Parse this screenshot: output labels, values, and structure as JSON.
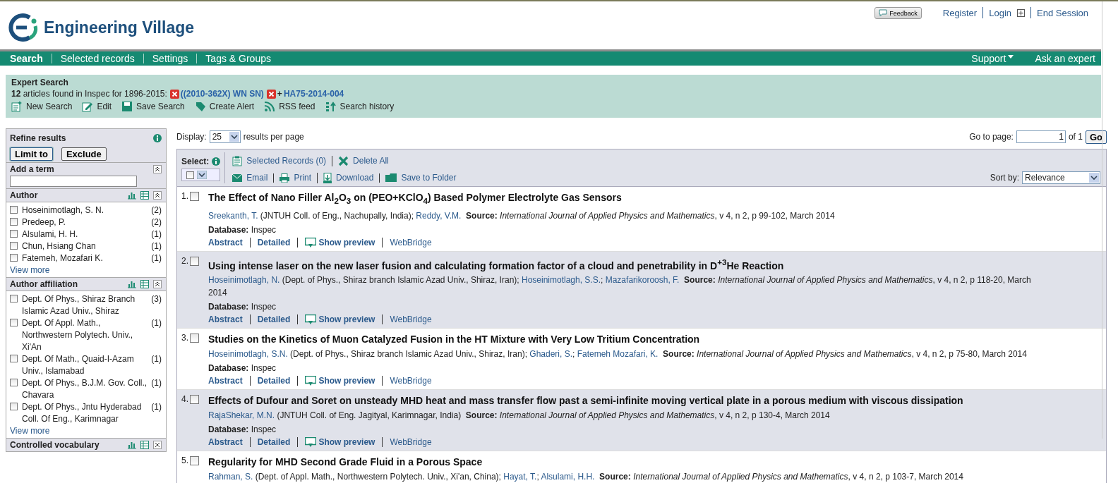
{
  "header": {
    "brand": "Engineering Village",
    "feedback": "Feedback",
    "links": [
      {
        "label": "Register",
        "kind": "link"
      },
      {
        "label": "Login",
        "kind": "login"
      },
      {
        "label": "End Session",
        "kind": "link"
      }
    ]
  },
  "nav": {
    "items": [
      {
        "label": "Search",
        "selected": true
      },
      {
        "label": "Selected records",
        "selected": false
      },
      {
        "label": "Settings",
        "selected": false
      },
      {
        "label": "Tags & Groups",
        "selected": false
      }
    ],
    "right": [
      {
        "label": "Support",
        "kind": "menu"
      },
      {
        "label": "Ask an expert",
        "kind": "link"
      }
    ]
  },
  "search_summary": {
    "title": "Expert Search",
    "found": "**12** articles found in Inspec for 1896-2015:",
    "terms": [
      {
        "text": "((2010-362X) WN SN)"
      },
      {
        "prefix": "+",
        "text": "HA75-2014-004"
      }
    ],
    "actions": [
      {
        "label": "New Search",
        "kind": "new"
      },
      {
        "label": "Edit",
        "kind": "edit"
      },
      {
        "label": "Save Search",
        "kind": "save"
      },
      {
        "label": "Create Alert",
        "kind": "alert"
      },
      {
        "label": "RSS feed",
        "kind": "rss"
      },
      {
        "label": "Search history",
        "kind": "history"
      }
    ]
  },
  "sidebar": {
    "title": "Refine results",
    "buttons": [
      "Limit to",
      "Exclude"
    ],
    "add_term": {
      "label": "Add a term"
    },
    "facets": [
      {
        "title": "Author",
        "items": [
          {
            "label": "Hoseinimotlagh, S. N.",
            "count": "(2)",
            "checked": false
          },
          {
            "label": "Predeep, P.",
            "count": "(2)",
            "checked": false
          },
          {
            "label": "Alsulami, H. H.",
            "count": "(1)",
            "checked": false
          },
          {
            "label": "Chun, Hsiang Chan",
            "count": "(1)",
            "checked": false
          },
          {
            "label": "Fatemeh, Mozafari K.",
            "count": "(1)",
            "checked": false
          }
        ],
        "more": "View more"
      },
      {
        "title": "Author affiliation",
        "items": [
          {
            "label": "Dept. Of Phys., Shiraz Branch Islamic Azad Univ., Shiraz",
            "count": "(3)",
            "checked": false
          },
          {
            "label": "Dept. Of Appl. Math., Northwestern Polytech. Univ., Xi'An",
            "count": "(1)",
            "checked": false
          },
          {
            "label": "Dept. Of Math., Quaid-I-Azam Univ., Islamabad",
            "count": "(1)",
            "checked": false
          },
          {
            "label": "Dept. Of Phys., B.J.M. Gov. Coll., Chavara",
            "count": "(1)",
            "checked": false
          },
          {
            "label": "Dept. Of Phys., Jntu Hyderabad Coll. Of Eng., Karimnagar",
            "count": "(1)",
            "checked": false
          }
        ],
        "more": "View more"
      },
      {
        "title": "Controlled vocabulary"
      }
    ]
  },
  "display": {
    "label": "Display:",
    "value": "25",
    "suffix": "results per page"
  },
  "pager": {
    "label": "Go to page:",
    "value": "1",
    "of": "of 1",
    "button": "Go"
  },
  "toolbar": {
    "select_label": "Select:",
    "row1": [
      {
        "label": "Selected Records (0)",
        "kind": "records"
      },
      {
        "label": "Delete All",
        "kind": "delete"
      }
    ],
    "row2": [
      {
        "label": "Email",
        "kind": "email"
      },
      {
        "label": "Print",
        "kind": "print"
      },
      {
        "label": "Download",
        "kind": "download"
      },
      {
        "label": "Save to Folder",
        "kind": "folder"
      }
    ],
    "sort_label": "Sort by:",
    "sort_value": "Relevance"
  },
  "results": [
    {
      "number": "1.",
      "checked": false,
      "title": "The Effect of Nano Filler Al$_{2}$O$_{3}$ on (PEO+KClO$_{4}$) Based Polymer Electrolyte Gas Sensors",
      "byline": [
        {
          "kind": "author",
          "text": "Sreekanth, T."
        },
        {
          "kind": "text",
          "text": " (JNTUH Coll. of Eng., Nachupally, India); "
        },
        {
          "kind": "author",
          "text": "Reddy, V.M."
        }
      ],
      "source_label": "Source:",
      "journal": "International Journal of Applied Physics and Mathematics",
      "details": ", v 4, n 2, p 99-102, March 2014",
      "db_label": "Database:",
      "database": "Inspec",
      "links": [
        "Abstract",
        "Detailed",
        "Show preview",
        "WebBridge"
      ]
    },
    {
      "number": "2.",
      "checked": false,
      "title": "Using intense laser on the new laser fusion and calculating formation factor of a cloud and penetrability in D$^{+3}$He Reaction",
      "byline": [
        {
          "kind": "author",
          "text": "Hoseinimotlagh, N."
        },
        {
          "kind": "text",
          "text": " (Dept. of Phys., Shiraz branch Islamic Azad Univ., Shiraz, Iran); "
        },
        {
          "kind": "author",
          "text": "Hoseinimotlagh, S.S."
        },
        {
          "kind": "text",
          "text": "; "
        },
        {
          "kind": "author",
          "text": "Mazafarikoroosh, F."
        }
      ],
      "source_label": "Source:",
      "journal": "International Journal of Applied Physics and Mathematics",
      "details": ", v 4, n 2, p 118-20, March 2014",
      "db_label": "Database:",
      "database": "Inspec",
      "links": [
        "Abstract",
        "Detailed",
        "Show preview",
        "WebBridge"
      ]
    },
    {
      "number": "3.",
      "checked": false,
      "title": "Studies on the Kinetics of Muon Catalyzed Fusion in the HT Mixture with Very Low Tritium Concentration",
      "byline": [
        {
          "kind": "author",
          "text": "Hoseinimotlagh, S.N."
        },
        {
          "kind": "text",
          "text": " (Dept. of Phys., Shiraz branch Islamic Azad Univ., Shiraz, Iran); "
        },
        {
          "kind": "author",
          "text": "Ghaderi, S."
        },
        {
          "kind": "text",
          "text": "; "
        },
        {
          "kind": "author",
          "text": "Fatemeh Mozafari, K."
        }
      ],
      "source_label": "Source:",
      "journal": "International Journal of Applied Physics and Mathematics",
      "details": ", v 4, n 2, p 75-80, March 2014",
      "db_label": "Database:",
      "database": "Inspec",
      "links": [
        "Abstract",
        "Detailed",
        "Show preview",
        "WebBridge"
      ]
    },
    {
      "number": "4.",
      "checked": false,
      "title": "Effects of Dufour and Soret on unsteady MHD heat and mass transfer flow past a semi-infinite moving vertical plate in a porous medium with viscous dissipation",
      "byline": [
        {
          "kind": "author",
          "text": "RajaShekar, M.N."
        },
        {
          "kind": "text",
          "text": " (JNTUH Coll. of Eng. Jagityal, Karimnagar, India)"
        }
      ],
      "source_label": "Source:",
      "journal": "International Journal of Applied Physics and Mathematics",
      "details": ", v 4, n 2, p 130-4, March 2014",
      "db_label": "Database:",
      "database": "Inspec",
      "links": [
        "Abstract",
        "Detailed",
        "Show preview",
        "WebBridge"
      ]
    },
    {
      "number": "5.",
      "checked": false,
      "title": "Regularity for MHD Second Grade Fluid in a Porous Space",
      "byline": [
        {
          "kind": "author",
          "text": "Rahman, S."
        },
        {
          "kind": "text",
          "text": " (Dept. of Appl. Math., Northwestern Polytech. Univ., Xi'an, China); "
        },
        {
          "kind": "author",
          "text": "Hayat, T."
        },
        {
          "kind": "text",
          "text": "; "
        },
        {
          "kind": "author",
          "text": "Alsulami, H.H."
        }
      ],
      "source_label": "Source:",
      "journal": "International Journal of Applied Physics and Mathematics",
      "details": ", v 4, n 2, p 103-7, March 2014"
    }
  ]
}
